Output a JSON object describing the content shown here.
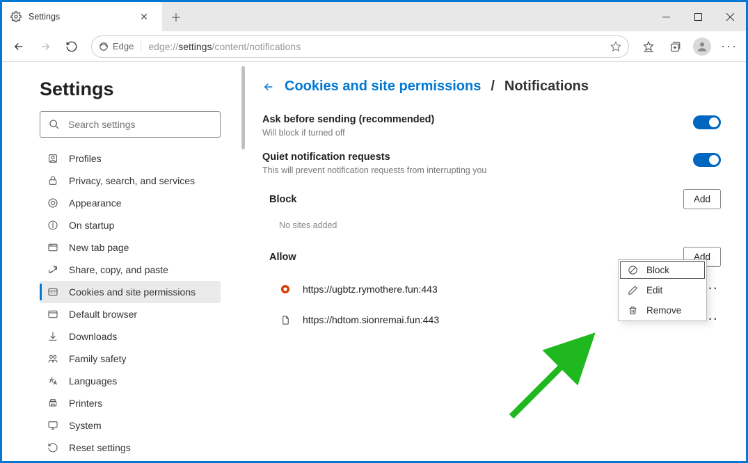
{
  "window": {
    "tab_title": "Settings",
    "url_prefix": "edge://",
    "url_dark": "settings",
    "url_rest": "/content/notifications",
    "site_label": "Edge"
  },
  "sidebar": {
    "heading": "Settings",
    "search_placeholder": "Search settings",
    "items": [
      {
        "label": "Profiles"
      },
      {
        "label": "Privacy, search, and services"
      },
      {
        "label": "Appearance"
      },
      {
        "label": "On startup"
      },
      {
        "label": "New tab page"
      },
      {
        "label": "Share, copy, and paste"
      },
      {
        "label": "Cookies and site permissions"
      },
      {
        "label": "Default browser"
      },
      {
        "label": "Downloads"
      },
      {
        "label": "Family safety"
      },
      {
        "label": "Languages"
      },
      {
        "label": "Printers"
      },
      {
        "label": "System"
      },
      {
        "label": "Reset settings"
      }
    ]
  },
  "main": {
    "breadcrumb_link": "Cookies and site permissions",
    "breadcrumb_sep": "/",
    "breadcrumb_current": "Notifications",
    "settings": [
      {
        "title": "Ask before sending (recommended)",
        "desc": "Will block if turned off"
      },
      {
        "title": "Quiet notification requests",
        "desc": "This will prevent notification requests from interrupting you"
      }
    ],
    "block": {
      "heading": "Block",
      "add": "Add",
      "empty": "No sites added"
    },
    "allow": {
      "heading": "Allow",
      "add": "Add",
      "sites": [
        {
          "url": "https://ugbtz.rymothere.fun:443"
        },
        {
          "url": "https://hdtom.sionremai.fun:443"
        }
      ]
    },
    "menu": {
      "block": "Block",
      "edit": "Edit",
      "remove": "Remove"
    }
  }
}
